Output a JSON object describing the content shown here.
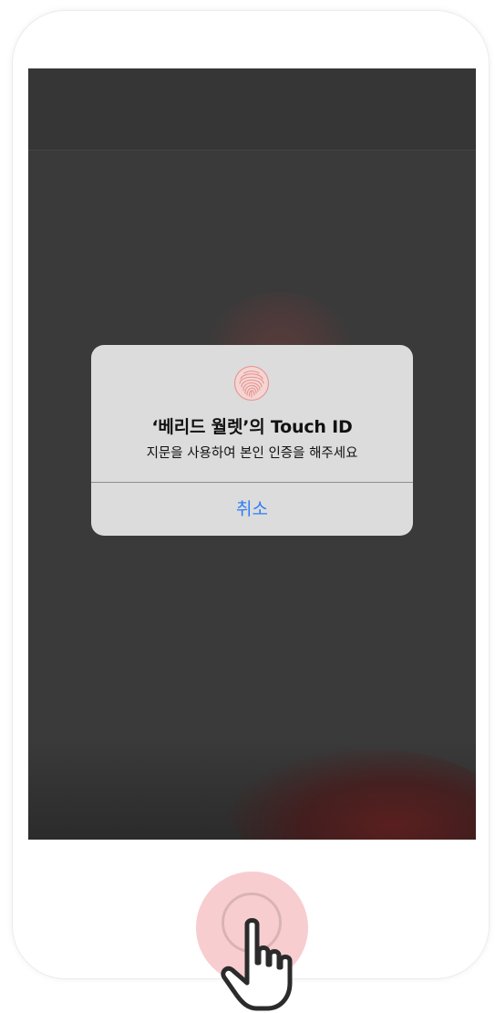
{
  "dialog": {
    "icon": "fingerprint-icon",
    "icon_color": "#e8928e",
    "title": "‘베리드 월렛’의 Touch ID",
    "message": "지문을 사용하여 본인 인증을 해주세요",
    "cancel_label": "취소",
    "cancel_color": "#2f7df6"
  },
  "home_button": {
    "highlight_color": "#f8cdd0"
  },
  "cursor": {
    "icon": "hand-pointer-icon"
  }
}
